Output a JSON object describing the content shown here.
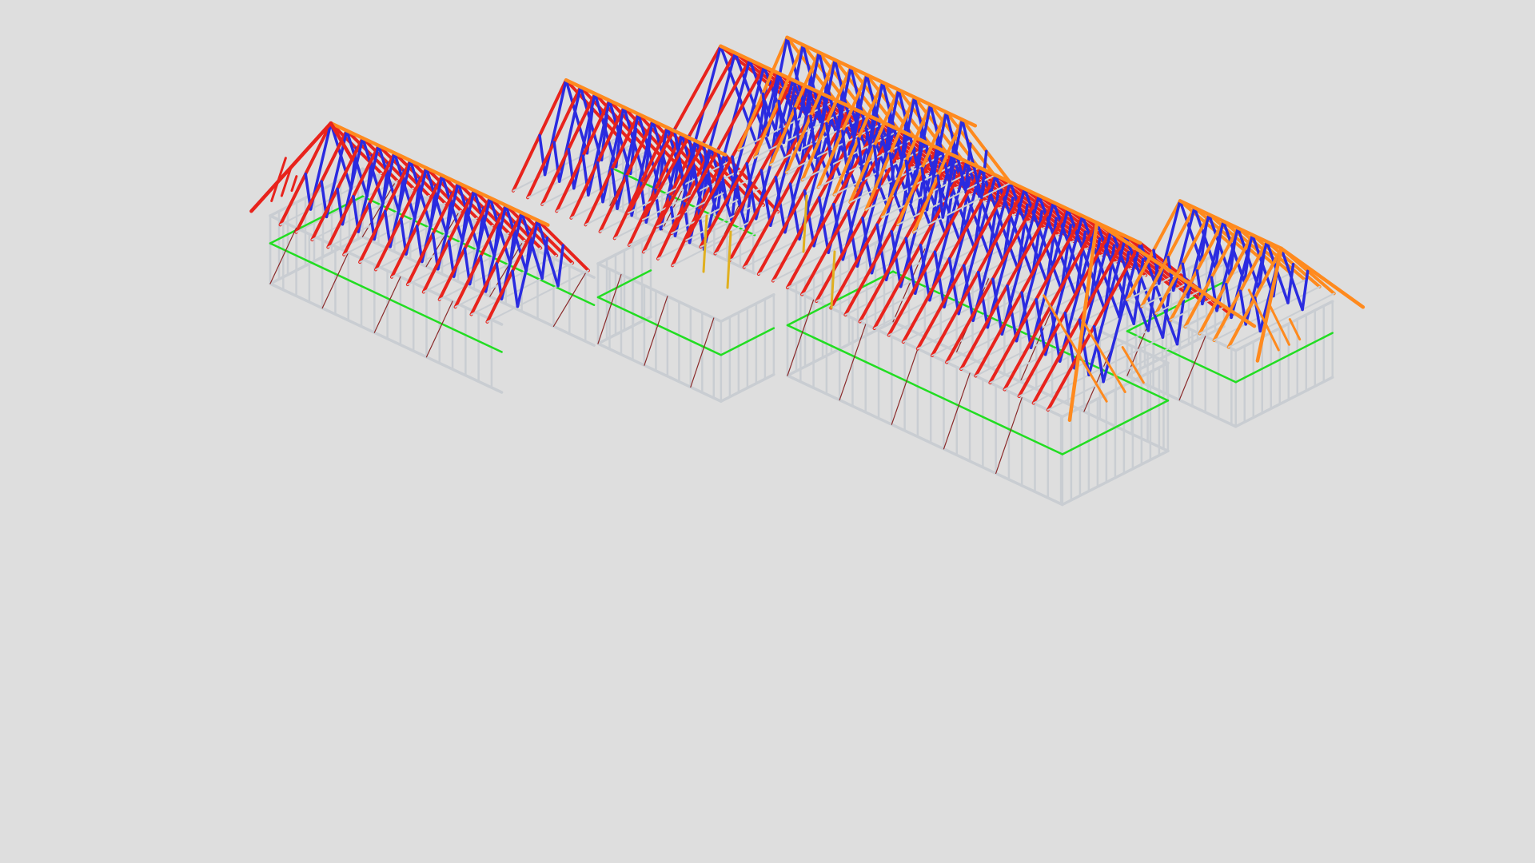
{
  "viewer": {
    "background_color": "#dedede"
  },
  "model": {
    "subject": "steel-frame-house-3d-model",
    "member_colors": {
      "wall_frame": "#c9cdd2",
      "wall_frame_shadow": "#9aa0a8",
      "nogging": "#22dd22",
      "top_chord": "#e8231c",
      "web": "#2a2be0",
      "hip_rafter": "#ff8a1e",
      "brace": "#8a2a2a",
      "post": "#e0b020"
    }
  }
}
